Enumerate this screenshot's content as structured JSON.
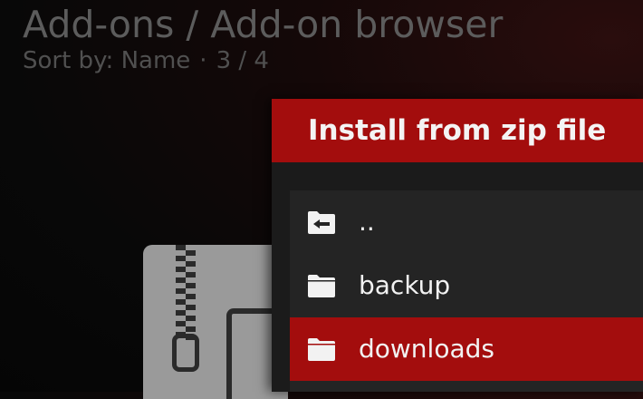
{
  "header": {
    "title": "Add-ons / Add-on browser",
    "sort_label": "Sort by: Name",
    "separator": "·",
    "position": "3 / 4"
  },
  "dialog": {
    "title": "Install from zip file",
    "items": [
      {
        "label": "..",
        "icon": "folder-back-icon",
        "selected": false
      },
      {
        "label": "backup",
        "icon": "folder-icon",
        "selected": false
      },
      {
        "label": "downloads",
        "icon": "folder-icon",
        "selected": true
      }
    ]
  },
  "colors": {
    "accent": "#a30d0d",
    "dialog_bg": "#1b1b1b",
    "list_bg": "#242424",
    "header_text": "#5c5c5c"
  }
}
